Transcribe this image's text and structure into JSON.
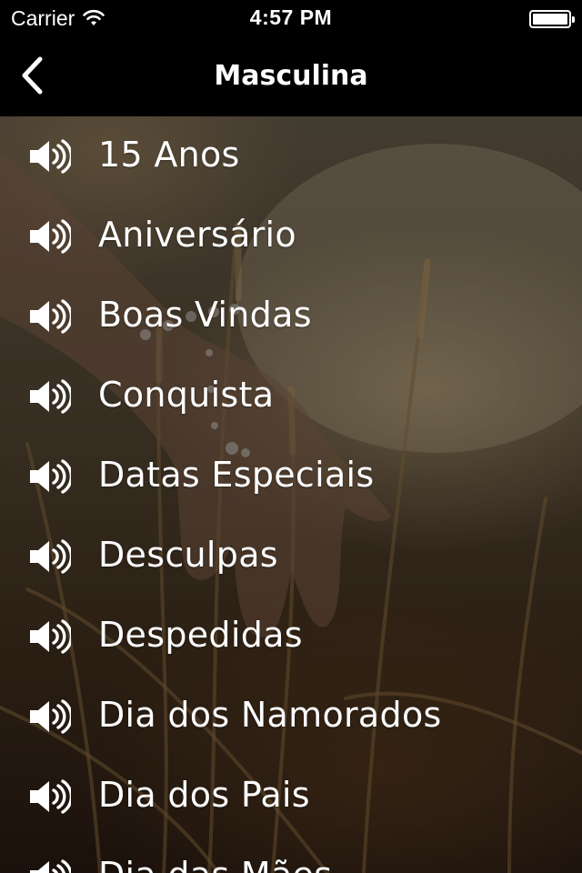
{
  "status_bar": {
    "carrier": "Carrier",
    "time": "4:57 PM",
    "icons": [
      "wifi-icon",
      "battery-icon"
    ]
  },
  "nav": {
    "title": "Masculina",
    "back_icon": "chevron-left-icon"
  },
  "list": {
    "item_icon": "speaker-icon",
    "items": [
      {
        "label": "15 Anos"
      },
      {
        "label": "Aniversário"
      },
      {
        "label": "Boas Vindas"
      },
      {
        "label": "Conquista"
      },
      {
        "label": "Datas Especiais"
      },
      {
        "label": "Desculpas"
      },
      {
        "label": "Despedidas"
      },
      {
        "label": "Dia dos Namorados"
      },
      {
        "label": "Dia dos Pais"
      },
      {
        "label": "Dia das Mães"
      }
    ]
  },
  "colors": {
    "bar_background": "#000000",
    "text": "#ffffff"
  }
}
